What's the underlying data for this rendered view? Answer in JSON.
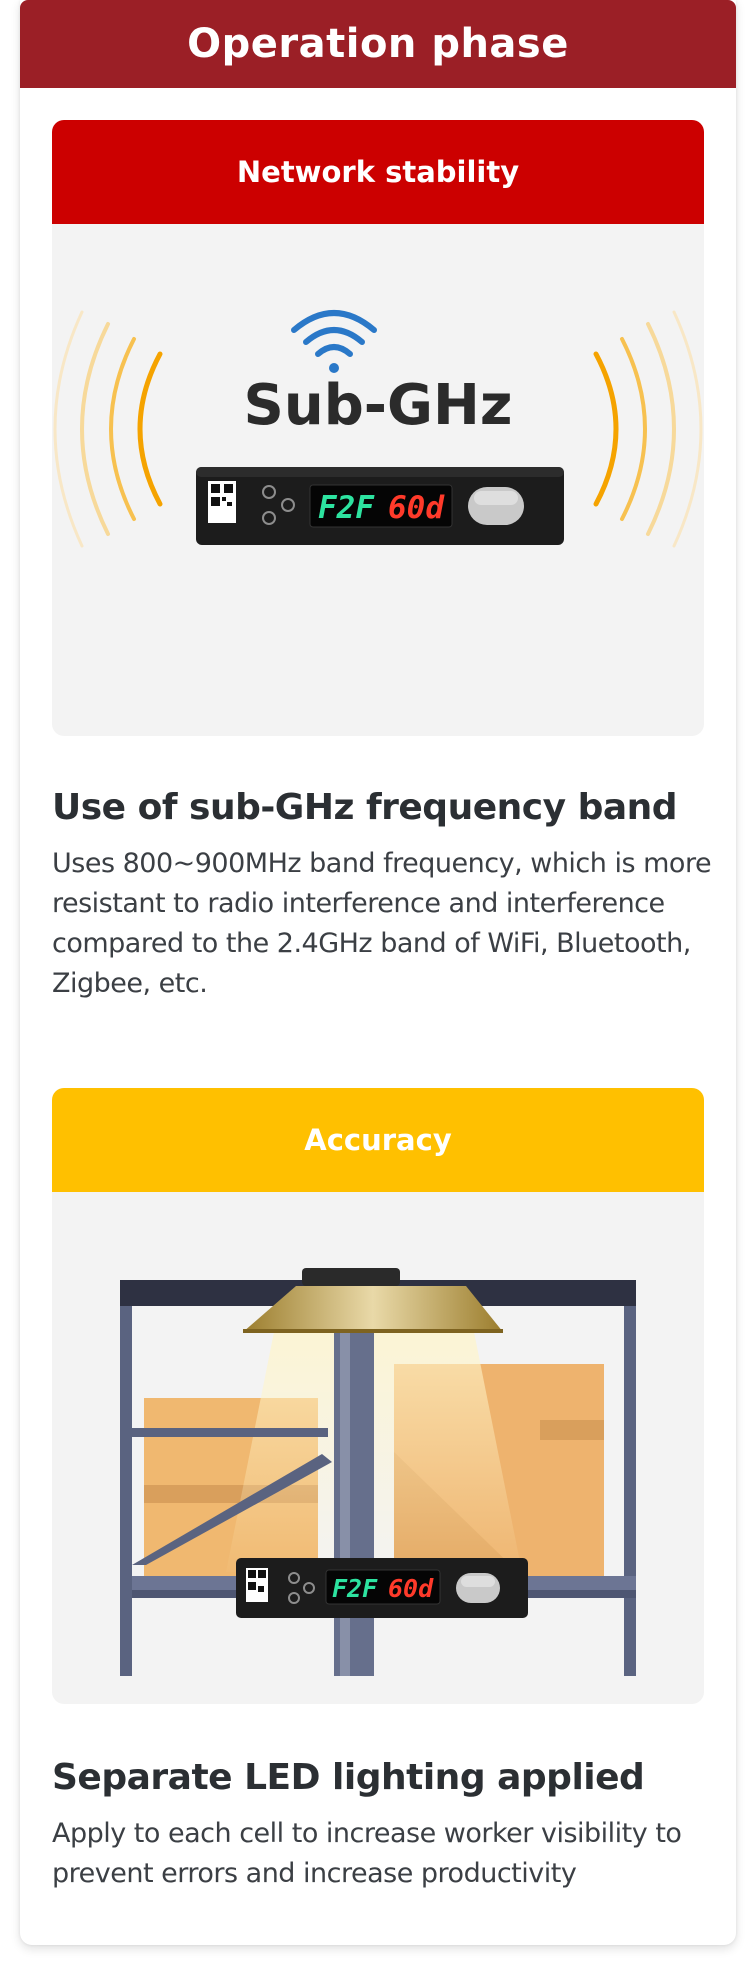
{
  "phase_title": "Operation phase",
  "colors": {
    "phase": "#9b1f26",
    "network_head": "#cc0000",
    "accuracy_head": "#ffc000",
    "led_green": "#2de3a0",
    "led_red": "#ff3a2a"
  },
  "sections": [
    {
      "header": "Network stability",
      "icon": "wifi-icon",
      "logo_text": "Sub-GHz",
      "device_display": {
        "green": "F2F",
        "red": "60d"
      },
      "title": "Use of sub-GHz frequency band",
      "description": "Uses 800~900MHz band frequency, which is more resistant to radio interference and interference compared to the 2.4GHz band of WiFi, Bluetooth, Zigbee, etc."
    },
    {
      "header": "Accuracy",
      "device_display": {
        "green": "F2F",
        "red": "60d"
      },
      "title": "Separate LED lighting applied",
      "description": "Apply to each cell to increase worker visibility to prevent errors and increase productivity"
    }
  ]
}
